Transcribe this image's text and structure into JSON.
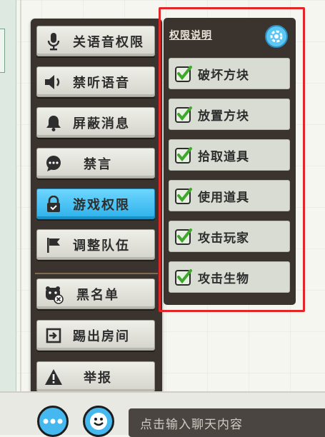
{
  "menu": {
    "items": [
      {
        "label": "关语音权限",
        "icon": "microphone-icon"
      },
      {
        "label": "禁听语音",
        "icon": "speaker-icon"
      },
      {
        "label": "屏蔽消息",
        "icon": "bell-icon"
      },
      {
        "label": "禁言",
        "icon": "chat-bubble-icon"
      },
      {
        "label": "游戏权限",
        "icon": "lock-icon",
        "active": true
      },
      {
        "label": "调整队伍",
        "icon": "flag-icon"
      },
      {
        "label": "黑名单",
        "icon": "blacklist-avatar-icon"
      },
      {
        "label": "踢出房间",
        "icon": "exit-icon"
      },
      {
        "label": "举报",
        "icon": "warning-icon"
      }
    ]
  },
  "permissions": {
    "title": "权限说明",
    "items": [
      {
        "label": "破坏方块",
        "checked": true
      },
      {
        "label": "放置方块",
        "checked": true
      },
      {
        "label": "拾取道具",
        "checked": true
      },
      {
        "label": "使用道具",
        "checked": true
      },
      {
        "label": "攻击玩家",
        "checked": true
      },
      {
        "label": "攻击生物",
        "checked": true
      }
    ]
  },
  "chat": {
    "placeholder": "点击输入聊天内容"
  },
  "colors": {
    "accent": "#46b8f0",
    "active_button": "#2db1ea",
    "panel_bg": "#3a332e",
    "check_green": "#3fa82c",
    "highlight_frame": "#e3262a"
  }
}
